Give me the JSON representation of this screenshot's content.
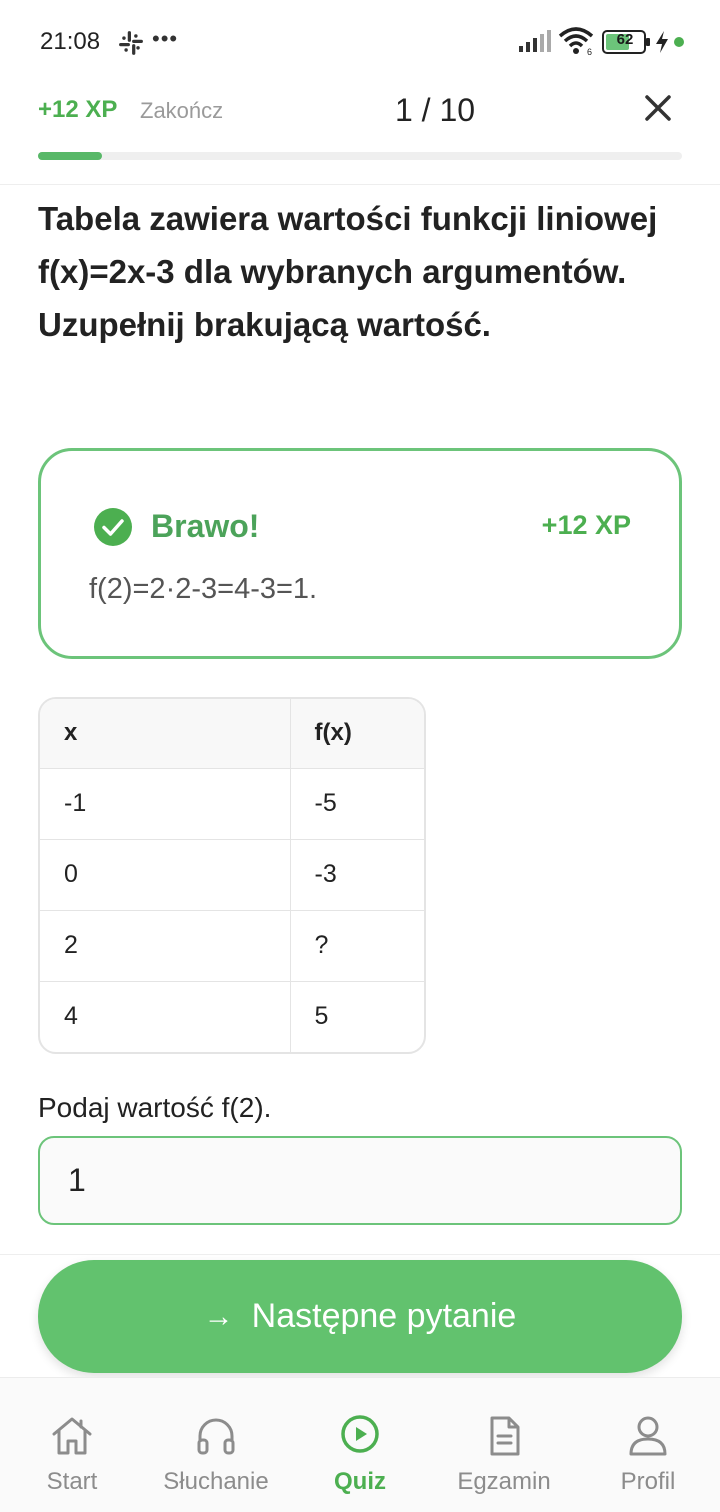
{
  "status_bar": {
    "time": "21:08",
    "battery": "62"
  },
  "header": {
    "xp": "+12 XP",
    "finish_label": "Zakończ",
    "progress_text": "1 / 10",
    "progress_fraction": 0.1
  },
  "question": {
    "text": "Tabela zawiera wartości funkcji liniowej f(x)=2x-3 dla wybranych argumentów. Uzupełnij brakującą wartość."
  },
  "feedback": {
    "title": "Brawo!",
    "xp": "+12 XP",
    "explanation": "f(2)=2·2-3=4-3=1."
  },
  "table": {
    "headers": [
      "x",
      "f(x)"
    ],
    "rows": [
      [
        "-1",
        "-5"
      ],
      [
        "0",
        "-3"
      ],
      [
        "2",
        "?"
      ],
      [
        "4",
        "5"
      ]
    ]
  },
  "answer": {
    "label": "Podaj wartość f(2).",
    "value": "1"
  },
  "next_button": {
    "label": "Następne pytanie"
  },
  "nav": {
    "items": [
      {
        "label": "Start",
        "icon": "home-icon"
      },
      {
        "label": "Słuchanie",
        "icon": "headphones-icon"
      },
      {
        "label": "Quiz",
        "icon": "play-circle-icon",
        "active": true
      },
      {
        "label": "Egzamin",
        "icon": "document-icon"
      },
      {
        "label": "Profil",
        "icon": "user-icon"
      }
    ]
  },
  "colors": {
    "accent": "#4caf50",
    "button": "#62c26e",
    "muted": "#9a9a9a"
  }
}
